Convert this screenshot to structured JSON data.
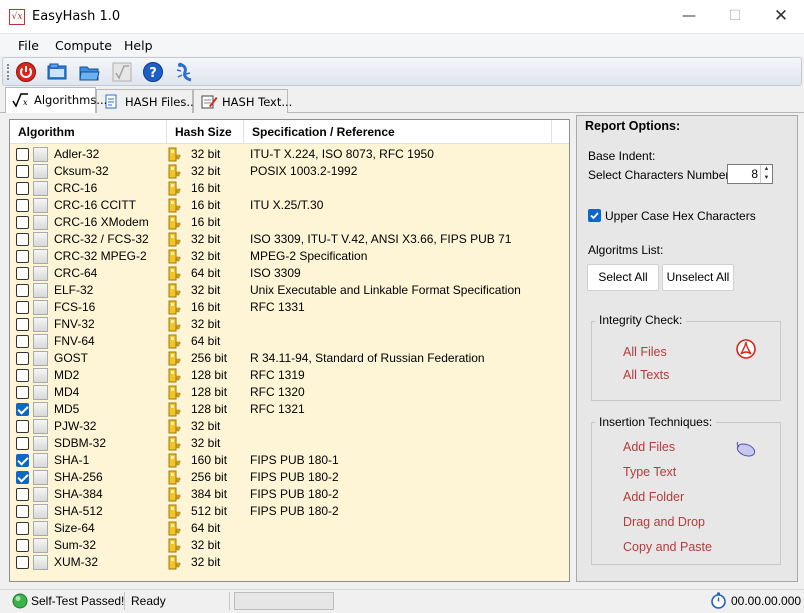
{
  "window": {
    "title": "EasyHash 1.0",
    "app_icon": "√x",
    "minimize": "—",
    "maximize": "☐",
    "close": "✕"
  },
  "menu": [
    "File",
    "Compute",
    "Help"
  ],
  "toolbar": [
    "power-icon",
    "open-folder-icon",
    "open-folder-blue-icon",
    "sqrt-icon",
    "help-icon",
    "gecko-icon"
  ],
  "tabs": [
    {
      "label": "Algorithms...",
      "icon": "sqrt-icon",
      "active": true
    },
    {
      "label": "HASH Files...",
      "icon": "file-icon",
      "active": false
    },
    {
      "label": "HASH Text...",
      "icon": "text-edit-icon",
      "active": false
    }
  ],
  "table": {
    "columns": [
      "Algorithm",
      "Hash Size",
      "Specification / Reference"
    ],
    "rows": [
      {
        "name": "Adler-32",
        "size": "32 bit",
        "spec": "ITU-T X.224, ISO 8073, RFC 1950",
        "checked": false
      },
      {
        "name": "Cksum-32",
        "size": "32 bit",
        "spec": "POSIX 1003.2-1992",
        "checked": false
      },
      {
        "name": "CRC-16",
        "size": "16 bit",
        "spec": "",
        "checked": false
      },
      {
        "name": "CRC-16 CCITT",
        "size": "16 bit",
        "spec": "ITU X.25/T.30",
        "checked": false
      },
      {
        "name": "CRC-16 XModem",
        "size": "16 bit",
        "spec": "",
        "checked": false
      },
      {
        "name": "CRC-32 / FCS-32",
        "size": "32 bit",
        "spec": "ISO 3309, ITU-T V.42, ANSI X3.66, FIPS PUB 71",
        "checked": false
      },
      {
        "name": "CRC-32 MPEG-2",
        "size": "32 bit",
        "spec": "MPEG-2 Specification",
        "checked": false
      },
      {
        "name": "CRC-64",
        "size": "64 bit",
        "spec": "ISO 3309",
        "checked": false
      },
      {
        "name": "ELF-32",
        "size": "32 bit",
        "spec": "Unix Executable and Linkable Format Specification",
        "checked": false
      },
      {
        "name": "FCS-16",
        "size": "16 bit",
        "spec": "RFC 1331",
        "checked": false
      },
      {
        "name": "FNV-32",
        "size": "32 bit",
        "spec": "",
        "checked": false
      },
      {
        "name": "FNV-64",
        "size": "64 bit",
        "spec": "",
        "checked": false
      },
      {
        "name": "GOST",
        "size": "256 bit",
        "spec": "R 34.11-94, Standard of Russian Federation",
        "checked": false
      },
      {
        "name": "MD2",
        "size": "128 bit",
        "spec": "RFC 1319",
        "checked": false
      },
      {
        "name": "MD4",
        "size": "128 bit",
        "spec": "RFC 1320",
        "checked": false
      },
      {
        "name": "MD5",
        "size": "128 bit",
        "spec": "RFC 1321",
        "checked": true
      },
      {
        "name": "PJW-32",
        "size": "32 bit",
        "spec": "",
        "checked": false
      },
      {
        "name": "SDBM-32",
        "size": "32 bit",
        "spec": "",
        "checked": false
      },
      {
        "name": "SHA-1",
        "size": "160 bit",
        "spec": "FIPS PUB 180-1",
        "checked": true
      },
      {
        "name": "SHA-256",
        "size": "256 bit",
        "spec": "FIPS PUB 180-2",
        "checked": true
      },
      {
        "name": "SHA-384",
        "size": "384 bit",
        "spec": "FIPS PUB 180-2",
        "checked": false
      },
      {
        "name": "SHA-512",
        "size": "512 bit",
        "spec": "FIPS PUB 180-2",
        "checked": false
      },
      {
        "name": "Size-64",
        "size": "64 bit",
        "spec": "",
        "checked": false
      },
      {
        "name": "Sum-32",
        "size": "32 bit",
        "spec": "",
        "checked": false
      },
      {
        "name": "XUM-32",
        "size": "32 bit",
        "spec": "",
        "checked": false
      }
    ]
  },
  "report": {
    "title": "Report Options:",
    "base_indent": "Base Indent:",
    "select_chars": "Select Characters Number:",
    "chars_value": "8",
    "uppercase_label": "Upper Case Hex Characters",
    "uppercase_checked": true,
    "algorithms_list": "Algoritms List:",
    "select_all": "Select All",
    "unselect_all": "Unselect All",
    "integrity": {
      "title": "Integrity Check:",
      "items": [
        "All Files",
        "All Texts"
      ]
    },
    "insertion": {
      "title": "Insertion Techniques:",
      "items": [
        "Add Files",
        "Type Text",
        "Add Folder",
        "Drag and Drop",
        "Copy and Paste"
      ]
    }
  },
  "status": {
    "self_test": "Self-Test Passed!",
    "state": "Ready",
    "timer": "00.00.00.000"
  },
  "colors": {
    "row_bg": "#fdf5d6",
    "link_red": "#b43c3c",
    "check_blue": "#0c67c7"
  }
}
